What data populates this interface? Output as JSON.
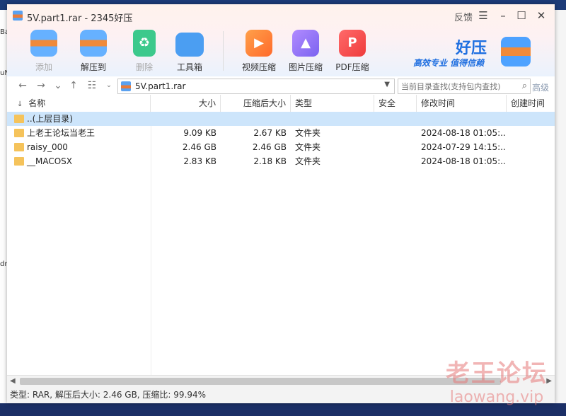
{
  "window": {
    "title": "5V.part1.rar - 2345好压",
    "feedback_label": "反馈",
    "menu_glyph": "☰",
    "minimize_glyph": "–",
    "maximize_glyph": "☐",
    "close_glyph": "✕"
  },
  "toolbar": {
    "items": [
      {
        "label": "添加",
        "icon": "add-box-icon",
        "enabled": false
      },
      {
        "label": "解压到",
        "icon": "extract-box-icon",
        "enabled": true
      },
      {
        "label": "删除",
        "icon": "recycle-icon",
        "enabled": false
      },
      {
        "label": "工具箱",
        "icon": "toolbox-icon",
        "enabled": true
      },
      {
        "label": "视频压缩",
        "icon": "video-compress-icon",
        "enabled": true
      },
      {
        "label": "图片压缩",
        "icon": "image-compress-icon",
        "enabled": true
      },
      {
        "label": "PDF压缩",
        "icon": "pdf-compress-icon",
        "enabled": true
      }
    ]
  },
  "brand": {
    "name": "好压",
    "slogan": "高效专业  值得信赖",
    "color": "#1f6fe0"
  },
  "address": {
    "path": "5V.part1.rar",
    "search_placeholder": "当前目录查找(支持包内查找)",
    "advanced_label": "高级"
  },
  "columns": [
    "名称",
    "大小",
    "压缩后大小",
    "类型",
    "安全",
    "修改时间",
    "创建时间"
  ],
  "sort_indicator": "↓",
  "rows": [
    {
      "name": "..(上层目录)",
      "size": "",
      "packed": "",
      "type": "",
      "security": "",
      "modified": "",
      "created": "",
      "selected": true
    },
    {
      "name": "上老王论坛当老王",
      "size": "9.09 KB",
      "packed": "2.67 KB",
      "type": "文件夹",
      "security": "",
      "modified": "2024-08-18 01:05:...",
      "created": "",
      "selected": false
    },
    {
      "name": "raisy_000",
      "size": "2.46 GB",
      "packed": "2.46 GB",
      "type": "文件夹",
      "security": "",
      "modified": "2024-07-29 14:15:...",
      "created": "",
      "selected": false
    },
    {
      "name": "__MACOSX",
      "size": "2.83 KB",
      "packed": "2.18 KB",
      "type": "文件夹",
      "security": "",
      "modified": "2024-08-18 01:05:...",
      "created": "",
      "selected": false
    }
  ],
  "status": {
    "text": "类型: RAR, 解压后大小: 2.46 GB, 压缩比: 99.94%"
  },
  "watermark": {
    "line1": "老王论坛",
    "line2": "laowang.vip"
  },
  "desktop": {
    "fragments": [
      "Ba",
      "uN",
      "dn"
    ]
  }
}
